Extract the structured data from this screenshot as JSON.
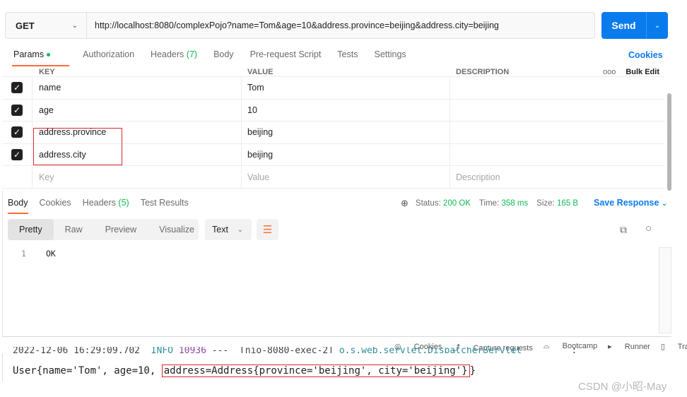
{
  "request": {
    "method": "GET",
    "url": "http://localhost:8080/complexPojo?name=Tom&age=10&address.province=beijing&address.city=beijing",
    "send_label": "Send"
  },
  "request_tabs": [
    {
      "label": "Params",
      "active": true
    },
    {
      "label": "Authorization"
    },
    {
      "label": "Headers",
      "count": "(7)"
    },
    {
      "label": "Body"
    },
    {
      "label": "Pre-request Script"
    },
    {
      "label": "Tests"
    },
    {
      "label": "Settings"
    }
  ],
  "cookies_link": "Cookies",
  "params_table": {
    "headers": {
      "key": "KEY",
      "value": "VALUE",
      "description": "DESCRIPTION",
      "more": "ooo",
      "bulk_edit": "Bulk Edit"
    },
    "rows": [
      {
        "key": "name",
        "value": "Tom",
        "checked": true
      },
      {
        "key": "age",
        "value": "10",
        "checked": true
      },
      {
        "key": "address.province",
        "value": "beijing",
        "checked": true
      },
      {
        "key": "address.city",
        "value": "beijing",
        "checked": true
      }
    ],
    "placeholders": {
      "key": "Key",
      "value": "Value",
      "description": "Description"
    }
  },
  "response_tabs": [
    {
      "label": "Body",
      "active": true
    },
    {
      "label": "Cookies"
    },
    {
      "label": "Headers",
      "count": "(5)"
    },
    {
      "label": "Test Results"
    }
  ],
  "response_status": {
    "status_label": "Status:",
    "status_value": "200 OK",
    "time_label": "Time:",
    "time_value": "358 ms",
    "size_label": "Size:",
    "size_value": "165 B",
    "save_response": "Save Response"
  },
  "format_tabs": [
    "Pretty",
    "Raw",
    "Preview",
    "Visualize"
  ],
  "format_type": "Text",
  "response_body": {
    "line": "1",
    "text": "OK"
  },
  "footer": [
    "Cookies",
    "Capture requests",
    "Bootcamp",
    "Runner",
    "Trash"
  ],
  "console": {
    "log_fragment": [
      "2022-12-06 16:29:09.702",
      "INFO",
      "10936",
      "---",
      "[nio-8080-exec-2]",
      "o.s.web.servlet.DispatcherServlet",
      ":"
    ],
    "output_prefix": "User{name='Tom', age=10, ",
    "output_highlight": "address=Address{province='beijing', city='beijing'}",
    "output_suffix": "}"
  },
  "watermark": "CSDN @小昭-May",
  "colors": {
    "accent": "#ff6c37",
    "primary": "#097bed",
    "success": "#0cbb52",
    "highlight_box": "#d9262c"
  }
}
